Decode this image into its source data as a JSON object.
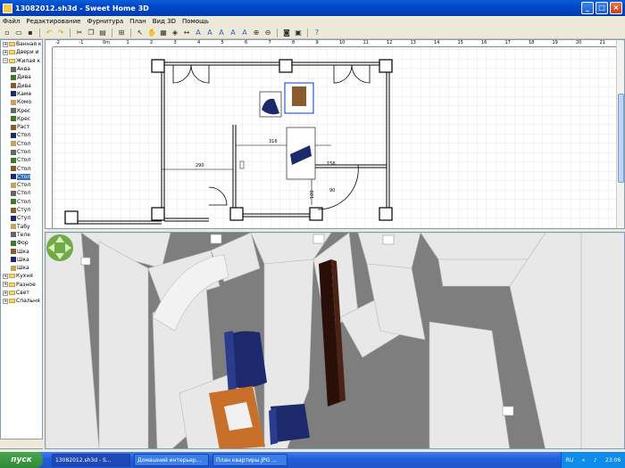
{
  "window": {
    "title": "13082012.sh3d - Sweet Home 3D"
  },
  "menu": [
    "Файл",
    "Редактирование",
    "Фурнитура",
    "План",
    "Вид 3D",
    "Помощь"
  ],
  "toolbar_icons": [
    "new-icon",
    "open-icon",
    "save-icon",
    "undo-icon",
    "redo-icon",
    "cut-icon",
    "copy-icon",
    "paste-icon",
    "add-furniture-icon",
    "select-icon",
    "pan-icon",
    "create-walls-icon",
    "create-rooms-icon",
    "create-dimensions-icon",
    "create-labels-icon",
    "text-style-icon",
    "text-size-up-icon",
    "text-size-down-icon",
    "zoom-in-icon",
    "zoom-out-icon",
    "photo-icon",
    "video-icon",
    "help-icon"
  ],
  "tree": [
    {
      "label": "Ванная к",
      "kind": "folder",
      "expanded": false
    },
    {
      "label": "Двери и",
      "kind": "folder",
      "expanded": false
    },
    {
      "label": "Жилая к",
      "kind": "folder",
      "expanded": true
    },
    {
      "label": "Аква",
      "kind": "item"
    },
    {
      "label": "Дива",
      "kind": "item"
    },
    {
      "label": "Дива",
      "kind": "item"
    },
    {
      "label": "Каме",
      "kind": "item"
    },
    {
      "label": "Комо",
      "kind": "item"
    },
    {
      "label": "Крес",
      "kind": "item"
    },
    {
      "label": "Крес",
      "kind": "item"
    },
    {
      "label": "Раст",
      "kind": "item"
    },
    {
      "label": "Стол",
      "kind": "item"
    },
    {
      "label": "Стол",
      "kind": "item"
    },
    {
      "label": "Стол",
      "kind": "item"
    },
    {
      "label": "Стол",
      "kind": "item"
    },
    {
      "label": "Стол",
      "kind": "item"
    },
    {
      "label": "Стол",
      "kind": "item",
      "selected": true
    },
    {
      "label": "Стол",
      "kind": "item"
    },
    {
      "label": "Стол",
      "kind": "item"
    },
    {
      "label": "Стол",
      "kind": "item"
    },
    {
      "label": "Стул",
      "kind": "item"
    },
    {
      "label": "Стул",
      "kind": "item"
    },
    {
      "label": "Табу",
      "kind": "item"
    },
    {
      "label": "Теле",
      "kind": "item"
    },
    {
      "label": "Фор",
      "kind": "item"
    },
    {
      "label": "Шка",
      "kind": "item"
    },
    {
      "label": "Шка",
      "kind": "item"
    },
    {
      "label": "Шка",
      "kind": "item"
    },
    {
      "label": "Кухня",
      "kind": "folder",
      "expanded": false
    },
    {
      "label": "Разное",
      "kind": "folder",
      "expanded": false
    },
    {
      "label": "Свет",
      "kind": "folder",
      "expanded": false
    },
    {
      "label": "Спальня",
      "kind": "folder",
      "expanded": false
    }
  ],
  "ruler": {
    "h": [
      "-2",
      "-1",
      "0m",
      "1",
      "2",
      "3",
      "4",
      "5",
      "6",
      "7",
      "8",
      "9",
      "10",
      "11",
      "12",
      "13",
      "14",
      "15",
      "16",
      "17",
      "18",
      "19",
      "20",
      "21",
      "22",
      "23"
    ],
    "v": [
      "0",
      "1",
      "2",
      "3",
      "4",
      "5",
      "6",
      "7",
      "8"
    ]
  },
  "dimensions": {
    "d1": "316",
    "d2": "290",
    "d3": "156",
    "d4": "90",
    "d5": "100"
  },
  "taskbar": {
    "start": "пуск",
    "items": [
      "13082012.sh3d - S...",
      "Домашний интерьер...",
      "План квартиры.JPG ..."
    ],
    "lang": "RU",
    "clock": "23:06"
  },
  "colors": {
    "sofa": "#1c2a6b",
    "shelf": "#2a0f08",
    "chair": "#c8702a",
    "walls": "#d8d8d8"
  }
}
